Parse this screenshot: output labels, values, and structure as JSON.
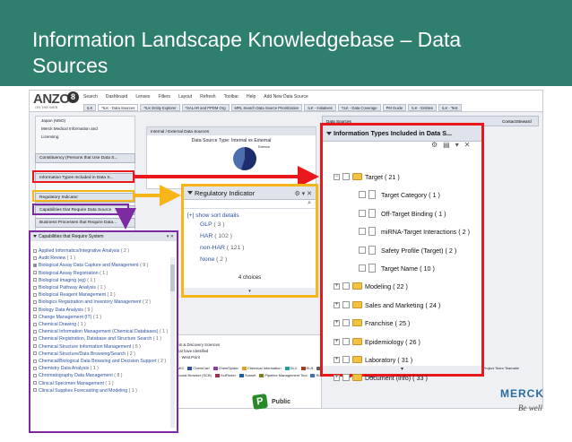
{
  "slide": {
    "title": "Information Landscape Knowledgebase – Data Sources",
    "public_label": "Public",
    "merck_name": "MERCK",
    "merck_tagline": "Be well"
  },
  "app": {
    "logo": "ANZO",
    "logo_suffix": "8",
    "logo_sub": "ON THE WEB",
    "toolbar": [
      "Search",
      "Dashboard",
      "Lenses",
      "Filters",
      "Layout",
      "Refresh",
      "Toolbar",
      "Help",
      "Add New Data Source"
    ],
    "tabs": [
      "ILK",
      "*ILK - Data Sources",
      "*ILK Entity Explorer",
      "*SALAR and PPDM Org",
      "MRL Search Data Source Prioritization",
      "ILK - Initiatives",
      "*ILK - Data Coverage",
      "PM Guide",
      "ILK - Entities",
      "ILK - Test"
    ],
    "left_tree": [
      "Japan (MSD)",
      "Merck Medical Information and",
      "Licensing"
    ],
    "sections": {
      "constituency": "Constituency (Persons that Use Data S...",
      "info_types": "Information Types Included in Data S...",
      "regulatory": "Regulatory Indicator",
      "capabilities": "Capabilities that Require Data Source",
      "business": "Business Processes that Require Data..."
    },
    "center_panel_title": "Internal / External Data Sources",
    "chart_title": "Data Source Type: Internal vs External",
    "chart_label": "External",
    "right_header": "Data Sources",
    "right_col_label": "ContactSteward",
    "bottom_panel": [
      "Therapeutics",
      "Early Development & Discovery Sciences",
      "Business Units that have Identified",
      "Pharmaceuticals - West Point"
    ]
  },
  "legend_items": [
    {
      "label": "AP",
      "color": "#e04040"
    },
    {
      "label": "COSMIC",
      "color": "#3a9a3a"
    },
    {
      "label": "ChemCart",
      "color": "#3050a0"
    },
    {
      "label": "ChemSpider",
      "color": "#8a40a0"
    },
    {
      "label": "Chemical Information",
      "color": "#e0a020"
    },
    {
      "label": "DLC",
      "color": "#20a0a0"
    },
    {
      "label": "ELN",
      "color": "#a04020"
    },
    {
      "label": "Administration (FDA) Website",
      "color": "#606060"
    },
    {
      "label": "CMRCDB",
      "color": "#4080c0"
    },
    {
      "label": "Google",
      "color": "#c03070"
    },
    {
      "label": "ICH",
      "color": "#70a030"
    },
    {
      "label": "Merck Knowledge Net",
      "color": "#5060c0"
    },
    {
      "label": "Project Team Teamsite",
      "color": "#d07030"
    },
    {
      "label": "Sample Compound Browser (SCB)",
      "color": "#309070"
    },
    {
      "label": "SciFinder",
      "color": "#a03050"
    },
    {
      "label": "Sunset",
      "color": "#2060a0"
    },
    {
      "label": "Pipeline Management Tool",
      "color": "#808020"
    },
    {
      "label": "Rosetta Resolver",
      "color": "#4070b0"
    },
    {
      "label": "PubMed",
      "color": "#b04040"
    },
    {
      "label": "WDA",
      "color": "#5a5a9a"
    }
  ],
  "regulatory": {
    "title": "Regulatory Indicator",
    "sort_link": "[+] show sort details",
    "items": [
      {
        "label": "GLP",
        "count": "( 3 )"
      },
      {
        "label": "HAR",
        "count": "( 102 )"
      },
      {
        "label": "non-HAR",
        "count": "( 121 )"
      },
      {
        "label": "None",
        "count": "( 2 )"
      }
    ],
    "footer": "4 choices"
  },
  "capabilities": {
    "title": "Capabilities that Require System",
    "items": [
      {
        "label": "Applied Informatics/Integrative Analysis",
        "count": "( 2 )",
        "checked": false
      },
      {
        "label": "Audit Review",
        "count": "( 1 )",
        "checked": false
      },
      {
        "label": "Biological Assay Data Capture and Management",
        "count": "( 9 )",
        "checked": true
      },
      {
        "label": "Biological Assay Registration",
        "count": "( 1 )",
        "checked": false
      },
      {
        "label": "Biological Imaging (eg)",
        "count": "( 1 )",
        "checked": false
      },
      {
        "label": "Biological Pathway Analysis",
        "count": "( 1 )",
        "checked": false
      },
      {
        "label": "Biological Reagent Management",
        "count": "( 2 )",
        "checked": false
      },
      {
        "label": "Biologics Registration and Inventory Management",
        "count": "( 2 )",
        "checked": false
      },
      {
        "label": "Biology Data Analysis",
        "count": "( 9 )",
        "checked": false
      },
      {
        "label": "Change Management (IT)",
        "count": "( 1 )",
        "checked": false
      },
      {
        "label": "Chemical Drawing",
        "count": "( 1 )",
        "checked": false
      },
      {
        "label": "Chemical Information Management (Chemical Databases)",
        "count": "( 1 )",
        "checked": false
      },
      {
        "label": "Chemical Registration, Database and Structure Search",
        "count": "( 1 )",
        "checked": false
      },
      {
        "label": "Chemical Structure Information Management",
        "count": "( 5 )",
        "checked": false
      },
      {
        "label": "Chemical Structure/Data Browsing/Search",
        "count": "( 2 )",
        "checked": false
      },
      {
        "label": "Chemical/Biological Data Browsing and Decision Support",
        "count": "( 2 )",
        "checked": false
      },
      {
        "label": "Chemistry Data Analysis",
        "count": "( 1 )",
        "checked": false
      },
      {
        "label": "Chromatography Data Management",
        "count": "( 8 )",
        "checked": false
      },
      {
        "label": "Clinical Specimen Management",
        "count": "( 1 )",
        "checked": false
      },
      {
        "label": "Clinical Supplies Forecasting and Modeling",
        "count": "( 1 )",
        "checked": false
      }
    ]
  },
  "info_types": {
    "title": "Information Types Included in Data S...",
    "rows": [
      {
        "label": "Target ( 21 )",
        "level": 0,
        "kind": "folder-open",
        "expander": "−"
      },
      {
        "label": "Target Category ( 1 )",
        "level": 1,
        "kind": "doc",
        "expander": ""
      },
      {
        "label": "Off-Target Binding ( 1 )",
        "level": 1,
        "kind": "doc",
        "expander": ""
      },
      {
        "label": "miRNA-Target Interactions ( 2 )",
        "level": 1,
        "kind": "doc",
        "expander": ""
      },
      {
        "label": "Safety Profile (Target) ( 2 )",
        "level": 1,
        "kind": "doc",
        "expander": ""
      },
      {
        "label": "Target Name ( 10 )",
        "level": 1,
        "kind": "doc",
        "expander": ""
      },
      {
        "label": "Modeling ( 22 )",
        "level": 0,
        "kind": "folder",
        "expander": "+"
      },
      {
        "label": "Sales and Marketing ( 24 )",
        "level": 0,
        "kind": "folder",
        "expander": "+"
      },
      {
        "label": "Franchise ( 25 )",
        "level": 0,
        "kind": "folder",
        "expander": "+"
      },
      {
        "label": "Epidemiology ( 26 )",
        "level": 0,
        "kind": "folder",
        "expander": "+"
      },
      {
        "label": "Laboratory ( 31 )",
        "level": 0,
        "kind": "folder",
        "expander": "+"
      },
      {
        "label": "Document (info) ( 33 )",
        "level": 0,
        "kind": "folder",
        "expander": "+"
      }
    ]
  }
}
